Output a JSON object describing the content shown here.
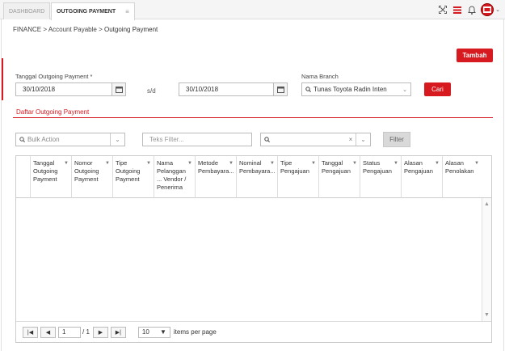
{
  "tabs": [
    {
      "label": "DASHBOARD"
    },
    {
      "label": "OUTGOING PAYMENT",
      "close": "≡"
    }
  ],
  "breadcrumb": {
    "part1": "FINANCE",
    "sep": ">",
    "part2": "Account Payable",
    "part3": "Outgoing Payment"
  },
  "buttons": {
    "tambah": "Tambah",
    "cari": "Cari",
    "filter": "Filter"
  },
  "form": {
    "date_label": "Tanggal Outgoing Payment *",
    "date_from": "30/10/2018",
    "sd": "s/d",
    "date_to": "30/10/2018",
    "branch_label": "Nama Branch",
    "branch_value": "Tunas Toyota Radin Inten"
  },
  "section_title": "Daftar Outgoing Payment",
  "filters": {
    "bulk_action": "Bulk Action",
    "teks_placeholder": "Teks Filter..."
  },
  "grid": {
    "columns": [
      "Tanggal Outgoing Payment",
      "Nomor Outgoing Payment",
      "Tipe Outgoing Payment",
      "Nama Pelanggan ... Vendor / Penerima",
      "Metode Pembayara...",
      "Nominal Pembayara...",
      "Tipe Pengajuan",
      "Tanggal Pengajuan",
      "Status Pengajuan",
      "Alasan Pengajuan",
      "Alasan Penolakan"
    ]
  },
  "pager": {
    "page": "1",
    "of": "/ 1",
    "page_size": "10",
    "items_per_page": "items per page"
  },
  "colors": {
    "accent": "#d71920"
  }
}
